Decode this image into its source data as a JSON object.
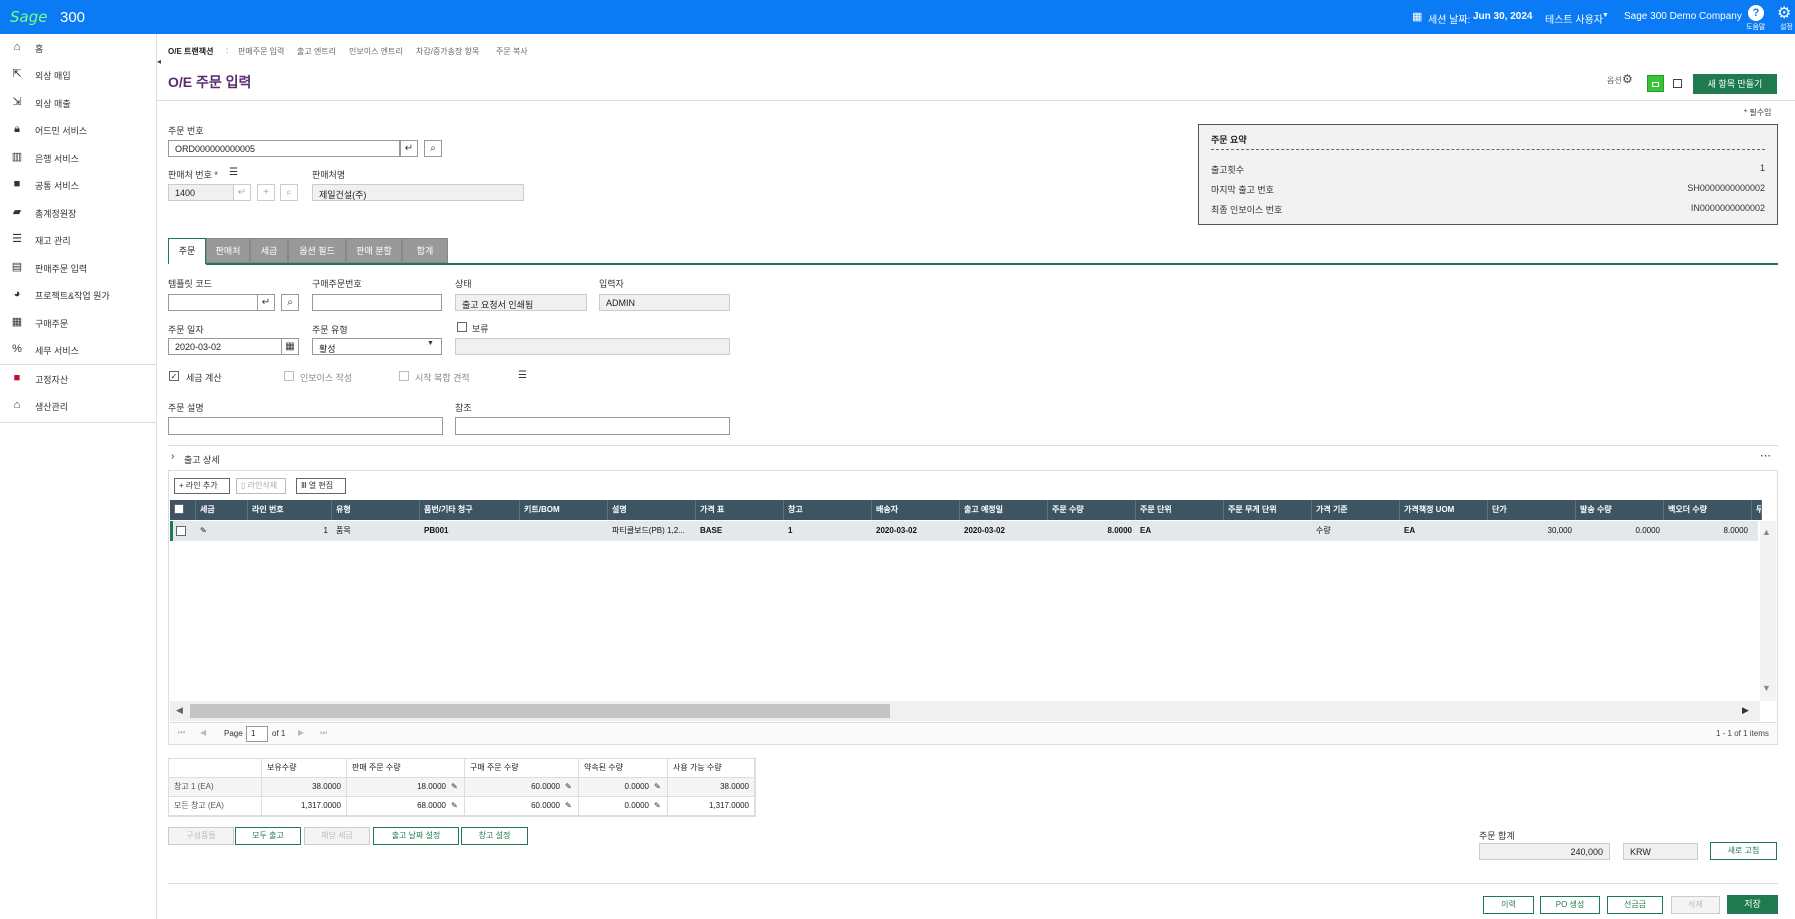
{
  "topbar": {
    "logo": "Sage",
    "product": "300",
    "session_label": "세션 날짜:",
    "session_date": "Jun 30, 2024",
    "user": "테스트 사용자",
    "company": "Sage 300 Demo Company",
    "help_label": "도움말",
    "settings_label": "설정"
  },
  "sidebar": {
    "items": [
      {
        "label": "홈",
        "icon": "home-icon"
      },
      {
        "label": "외상 매입",
        "icon": "payables-icon"
      },
      {
        "label": "외상 매출",
        "icon": "receivables-icon"
      },
      {
        "label": "어드민 서비스",
        "icon": "lock-icon"
      },
      {
        "label": "은행 서비스",
        "icon": "bank-icon"
      },
      {
        "label": "공통 서비스",
        "icon": "briefcase-icon"
      },
      {
        "label": "총계정원장",
        "icon": "folder-icon"
      },
      {
        "label": "재고 관리",
        "icon": "inventory-icon"
      },
      {
        "label": "판매주문 입력",
        "icon": "document-icon"
      },
      {
        "label": "프로젝트&작업 원가",
        "icon": "pie-chart-icon"
      },
      {
        "label": "구매주문",
        "icon": "grid-icon"
      },
      {
        "label": "세무 서비스",
        "icon": "percent-icon"
      },
      {
        "label": "고정자산",
        "icon": "fixed-assets-icon"
      },
      {
        "label": "생산관리",
        "icon": "factory-icon"
      }
    ]
  },
  "breadcrumb": {
    "root": "O/E 트랜잭션",
    "sep": ":",
    "links": [
      "판매주문 입력",
      "출고 엔트리",
      "인보이스 엔트리",
      "차감/증가송장 항목",
      "주문 복사"
    ]
  },
  "page": {
    "title": "O/E 주문 입력",
    "options_label": "옵션",
    "new_button": "새 항목 만들기",
    "required_note": "* 필수임"
  },
  "header_form": {
    "order_no_label": "주문 번호",
    "order_no": "ORD000000000005",
    "customer_no_label": "판매처 번호 *",
    "customer_no": "1400",
    "customer_name_label": "판매처명",
    "customer_name": "제일건설(주)"
  },
  "summary": {
    "title": "주문 요약",
    "rows": [
      {
        "label": "출고횟수",
        "value": "1"
      },
      {
        "label": "마지막 출고 번호",
        "value": "SH0000000000002"
      },
      {
        "label": "최종 인보이스 번호",
        "value": "IN0000000000002"
      }
    ]
  },
  "tabs": [
    "주문",
    "판매처",
    "세금",
    "옵션 필드",
    "판매 분할",
    "합계"
  ],
  "order_form": {
    "template_label": "템플릿 코드",
    "template": "",
    "po_label": "구매주문번호",
    "po": "",
    "status_label": "상태",
    "status": "출고 요청서 인쇄됨",
    "entered_by_label": "입력자",
    "entered_by": "ADMIN",
    "date_label": "주문 일자",
    "date": "2020-03-02",
    "type_label": "주문 유형",
    "type": "활성",
    "hold_label": "보류",
    "hold_reason": "",
    "tax_calc_label": "세금 계산",
    "invoice_label": "인보이스 작성",
    "multi_quote_label": "시작 복합 견적",
    "desc_label": "주문 설명",
    "desc": "",
    "ref_label": "참조",
    "ref": ""
  },
  "details": {
    "section_title": "출고 상세",
    "add_line": "라인 추가",
    "delete_line": "라인삭제",
    "edit_columns": "열 편집",
    "columns": [
      "세금",
      "라인 번호",
      "유형",
      "품번/기타 청구",
      "키트/BOM",
      "설명",
      "가격 표",
      "창고",
      "배송자",
      "출고 예정일",
      "주문 수량",
      "주문 단위",
      "주문 무게 단위",
      "가격 기준",
      "가격책정 UOM",
      "단가",
      "발송 수량",
      "백오더 수량",
      "무"
    ],
    "rows": [
      {
        "tax": "",
        "line": "1",
        "type": "품목",
        "item": "PB001",
        "kit": "",
        "desc": "파티클보드(PB) 1,2...",
        "price_list": "BASE",
        "location": "1",
        "ship_via": "2020-03-02",
        "exp_ship": "2020-03-02",
        "qty": "8.0000",
        "uom": "EA",
        "weight_uom": "",
        "price_by": "수량",
        "pricing_uom": "EA",
        "unit_price": "30,000",
        "shipped": "0.0000",
        "backorder": "8.0000"
      }
    ],
    "pager": {
      "page_label": "Page",
      "page": "1",
      "of": "of 1",
      "count": "1 - 1 of 1 items"
    }
  },
  "stock": {
    "headers": [
      "",
      "보유수량",
      "판매 주문 수량",
      "구매 주문 수량",
      "약속된 수량",
      "사용 가능 수량"
    ],
    "rows": [
      [
        "창고 1 (EA)",
        "38.0000",
        "18.0000",
        "60.0000",
        "0.0000",
        "38.0000"
      ],
      [
        "모든 창고 (EA)",
        "1,317.0000",
        "68.0000",
        "60.0000",
        "0.0000",
        "1,317.0000"
      ]
    ]
  },
  "action_buttons": [
    "구성품들",
    "모두 출고",
    "해당 세금",
    "출고 날짜 설정",
    "창고 설정"
  ],
  "totals": {
    "label": "주문 합계",
    "amount": "240,000",
    "currency": "KRW",
    "refresh": "새로 고침"
  },
  "footer_buttons": [
    "이력",
    "PO 생성",
    "선금금",
    "삭제",
    "저장"
  ]
}
